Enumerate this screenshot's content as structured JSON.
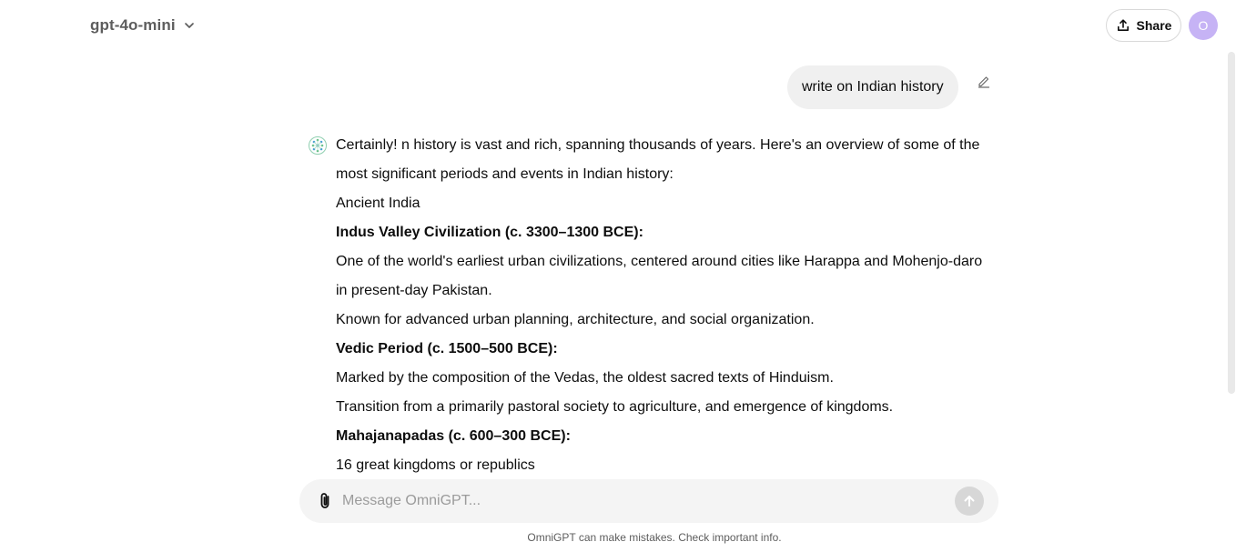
{
  "header": {
    "model_name": "gpt-4o-mini",
    "share_label": "Share",
    "avatar_initial": "O"
  },
  "conversation": {
    "user_message": "write on Indian history",
    "assistant_paragraphs": [
      {
        "text": "Certainly! n history is vast and rich, spanning thousands of years. Here's an overview of some of the most significant periods and events in Indian history:",
        "bold": false
      },
      {
        "text": "Ancient India",
        "bold": false
      },
      {
        "text": "Indus Valley Civilization (c. 3300–1300 BCE):",
        "bold": true
      },
      {
        "text": "One of the world's earliest urban civilizations, centered around cities like Harappa and Mohenjo-daro in present-day Pakistan.",
        "bold": false
      },
      {
        "text": "Known for advanced urban planning, architecture, and social organization.",
        "bold": false
      },
      {
        "text": "Vedic Period (c. 1500–500 BCE):",
        "bold": true
      },
      {
        "text": "Marked by the composition of the Vedas, the oldest sacred texts of Hinduism.",
        "bold": false
      },
      {
        "text": "Transition from a primarily pastoral society to agriculture, and emergence of kingdoms.",
        "bold": false
      },
      {
        "text": "Mahajanapadas (c. 600–300 BCE):",
        "bold": true
      },
      {
        "text": "16 great kingdoms or republics",
        "bold": false
      }
    ]
  },
  "composer": {
    "placeholder": "Message OmniGPT...",
    "value": ""
  },
  "footer": {
    "disclaimer": "OmniGPT can make mistakes. Check important info."
  },
  "colors": {
    "avatar_bg": "#c6b3f5",
    "bubble_bg": "#f0f0f0",
    "composer_bg": "#f4f4f4",
    "send_disabled": "#d7d7d7"
  },
  "icons": {
    "model_dropdown": "chevron-down-icon",
    "share": "share-upload-icon",
    "edit": "pencil-icon",
    "assistant": "omnigpt-logo-icon",
    "attach": "paperclip-icon",
    "send": "arrow-up-icon"
  }
}
